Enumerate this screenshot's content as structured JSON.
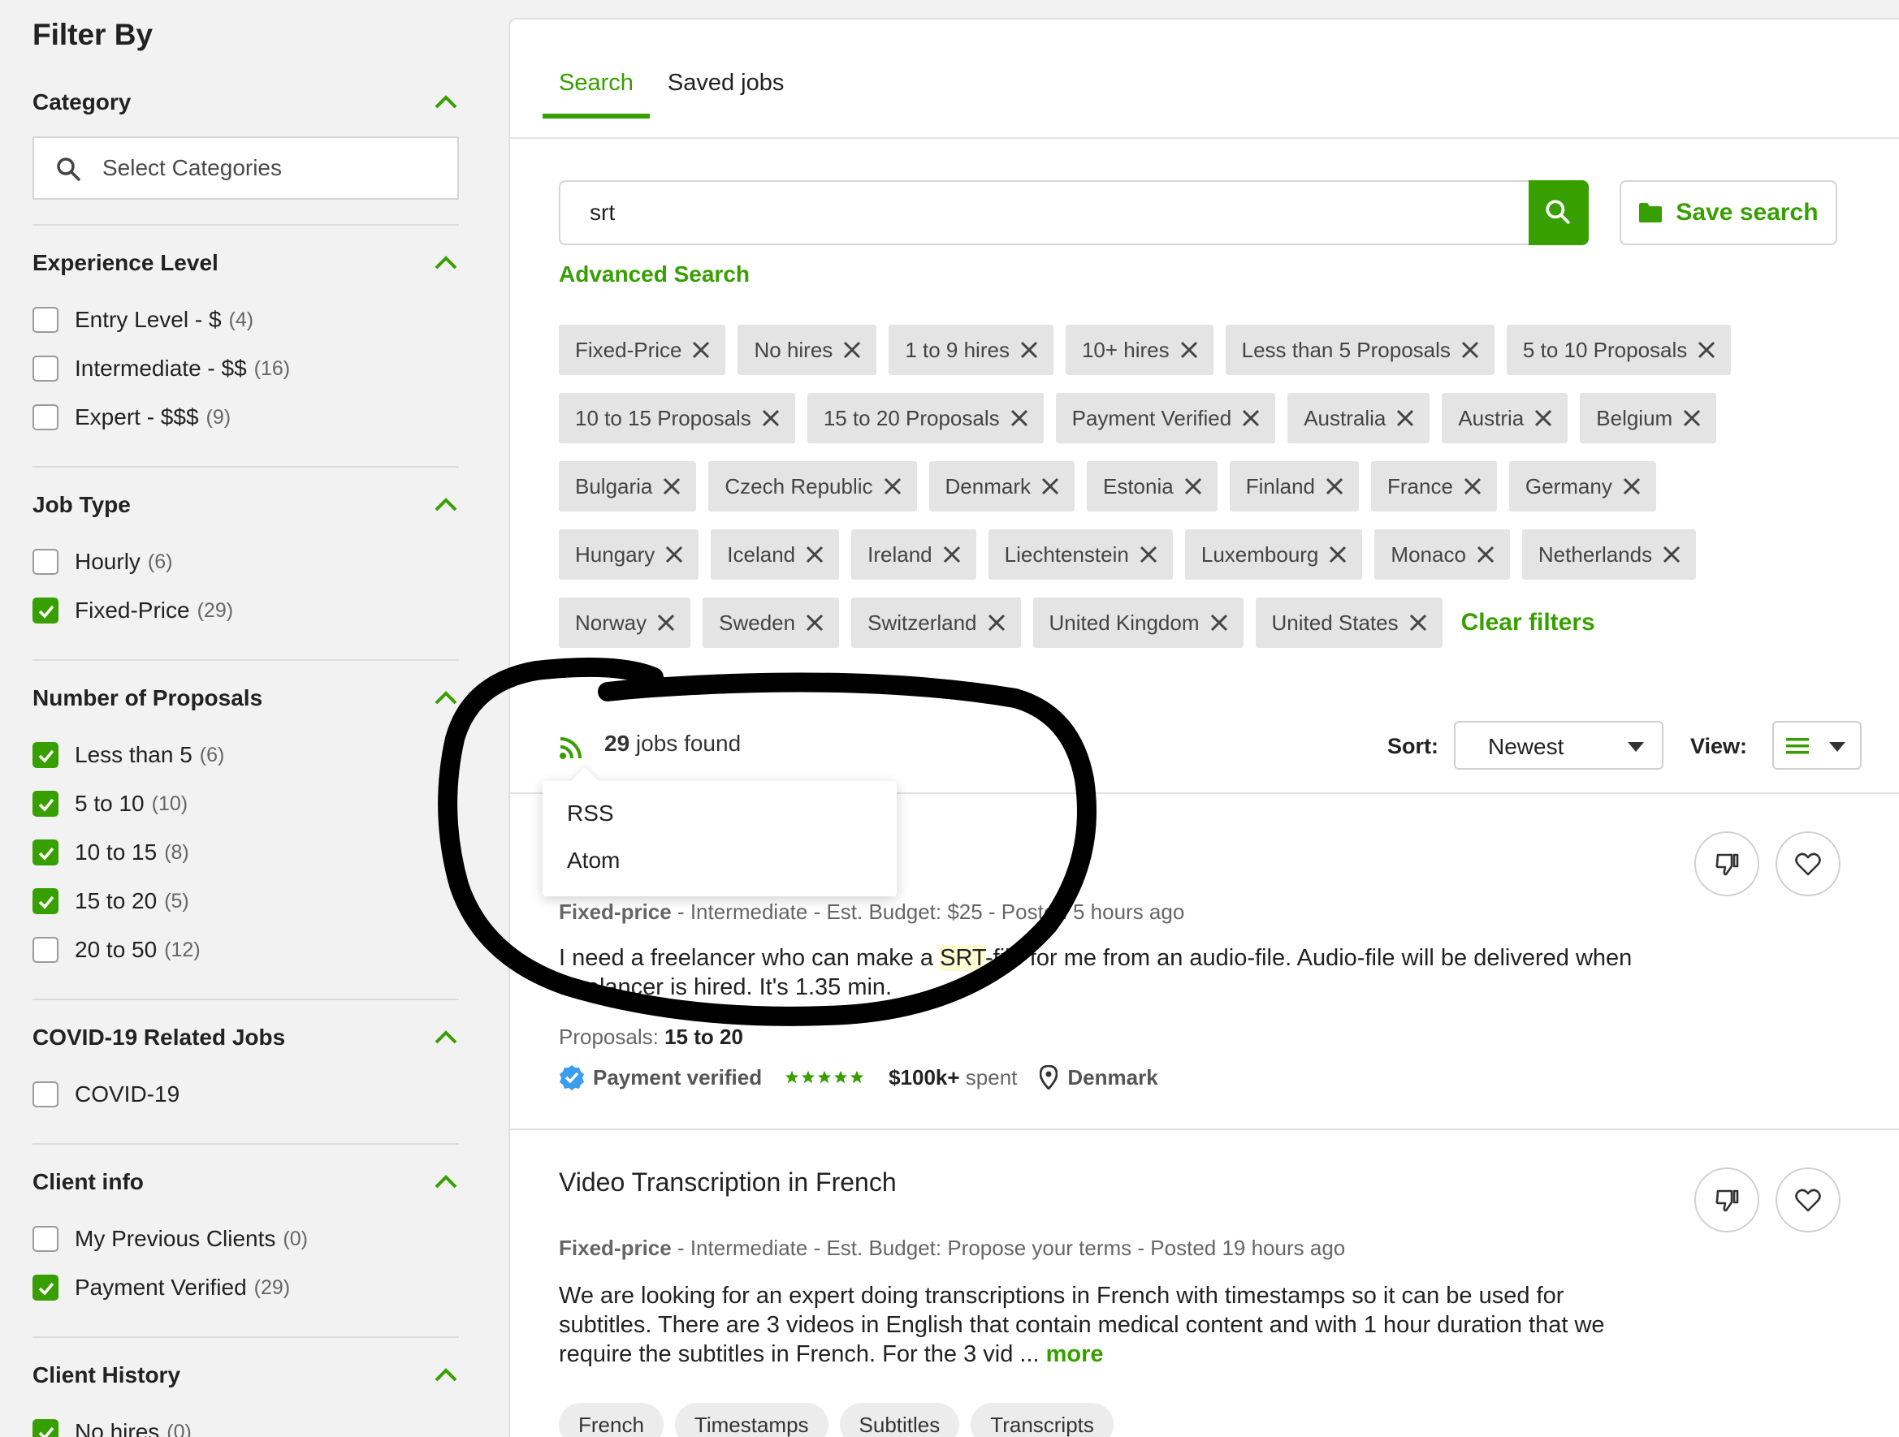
{
  "sidebar": {
    "title": "Filter By",
    "category": {
      "label": "Category",
      "placeholder": "Select Categories"
    },
    "experience": {
      "label": "Experience Level",
      "options": [
        {
          "label": "Entry Level - $",
          "count": "(4)",
          "checked": false
        },
        {
          "label": "Intermediate - $$",
          "count": "(16)",
          "checked": false
        },
        {
          "label": "Expert - $$$",
          "count": "(9)",
          "checked": false
        }
      ]
    },
    "job_type": {
      "label": "Job Type",
      "options": [
        {
          "label": "Hourly",
          "count": "(6)",
          "checked": false
        },
        {
          "label": "Fixed-Price",
          "count": "(29)",
          "checked": true
        }
      ]
    },
    "proposals": {
      "label": "Number of Proposals",
      "options": [
        {
          "label": "Less than 5",
          "count": "(6)",
          "checked": true
        },
        {
          "label": "5 to 10",
          "count": "(10)",
          "checked": true
        },
        {
          "label": "10 to 15",
          "count": "(8)",
          "checked": true
        },
        {
          "label": "15 to 20",
          "count": "(5)",
          "checked": true
        },
        {
          "label": "20 to 50",
          "count": "(12)",
          "checked": false
        }
      ]
    },
    "covid": {
      "label": "COVID-19 Related Jobs",
      "options": [
        {
          "label": "COVID-19",
          "count": "",
          "checked": false
        }
      ]
    },
    "client_info": {
      "label": "Client info",
      "options": [
        {
          "label": "My Previous Clients",
          "count": "(0)",
          "checked": false
        },
        {
          "label": "Payment Verified",
          "count": "(29)",
          "checked": true
        }
      ]
    },
    "client_history": {
      "label": "Client History",
      "options": [
        {
          "label": "No hires",
          "count": "(0)",
          "checked": true
        }
      ]
    }
  },
  "main": {
    "tabs": [
      {
        "label": "Search",
        "active": true
      },
      {
        "label": "Saved jobs",
        "active": false
      }
    ],
    "search": {
      "value": "srt",
      "save_label": "Save search",
      "advanced_label": "Advanced Search"
    },
    "chip_rows": [
      [
        "Fixed-Price",
        "No hires",
        "1 to 9 hires",
        "10+ hires",
        "Less than 5 Proposals",
        "5 to 10 Proposals"
      ],
      [
        "10 to 15 Proposals",
        "15 to 20 Proposals",
        "Payment Verified",
        "Australia",
        "Austria",
        "Belgium"
      ],
      [
        "Bulgaria",
        "Czech Republic",
        "Denmark",
        "Estonia",
        "Finland",
        "France",
        "Germany"
      ],
      [
        "Hungary",
        "Iceland",
        "Ireland",
        "Liechtenstein",
        "Luxembourg",
        "Monaco",
        "Netherlands"
      ],
      [
        "Norway",
        "Sweden",
        "Switzerland",
        "United Kingdom",
        "United States"
      ]
    ],
    "clear_filters": "Clear filters",
    "results": {
      "count": "29",
      "found_text": " jobs found",
      "sort_label": "Sort:",
      "sort_value": "Newest",
      "view_label": "View:"
    },
    "feed_menu": {
      "items": [
        "RSS",
        "Atom"
      ]
    },
    "jobs": [
      {
        "title": "",
        "type": "Fixed-price",
        "meta": " - Intermediate - Est. Budget: $25 - Posted 5 hours ago",
        "desc_before": "I need a freelancer who can make a ",
        "desc_highlight": "SRT",
        "desc_after": "-file for me from an audio-file. Audio-file will be delivered when freelancer is hired. It's 1.35 min.",
        "proposals_label": "Proposals: ",
        "proposals_value": "15 to 20",
        "payment_verified": "Payment verified",
        "spent_value": "$100k+",
        "spent_label": " spent",
        "location": "Denmark"
      },
      {
        "title": "Video Transcription in French",
        "type": "Fixed-price",
        "meta": " - Intermediate - Est. Budget: Propose your terms - Posted 19 hours ago",
        "desc": "We are looking for an expert doing transcriptions in French with timestamps so it can be used for subtitles. There are 3 videos in English that contain medical content and with 1 hour duration that we require the subtitles in French. For the 3 vid ... ",
        "more": "more",
        "skills": [
          "French",
          "Timestamps",
          "Subtitles",
          "Transcripts"
        ]
      }
    ]
  },
  "colors": {
    "brand_green": "#37a000",
    "chip_bg": "#e4e4e4",
    "verified_blue": "#3b9ded",
    "annotation_ink": "#000000"
  }
}
